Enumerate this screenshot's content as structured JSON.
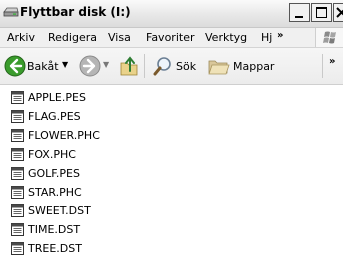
{
  "window": {
    "title": "Flyttbar disk (I:)",
    "icon": "removable-disk-icon"
  },
  "menubar": {
    "items": [
      "Arkiv",
      "Redigera",
      "Visa",
      "Favoriter",
      "Verktyg",
      "Hj"
    ],
    "overflow": "»"
  },
  "toolbar": {
    "back_label": "Bakåt",
    "search_label": "Sök",
    "folders_label": "Mappar",
    "overflow": "»"
  },
  "files": [
    {
      "name": "APPLE.PES"
    },
    {
      "name": "FLAG.PES"
    },
    {
      "name": "FLOWER.PHC"
    },
    {
      "name": "FOX.PHC"
    },
    {
      "name": "GOLF.PES"
    },
    {
      "name": "STAR.PHC"
    },
    {
      "name": "SWEET.DST"
    },
    {
      "name": "TIME.DST"
    },
    {
      "name": "TREE.DST"
    }
  ],
  "colors": {
    "back_green": "#3a9b2c",
    "forward_gray": "#b5b5b5"
  }
}
